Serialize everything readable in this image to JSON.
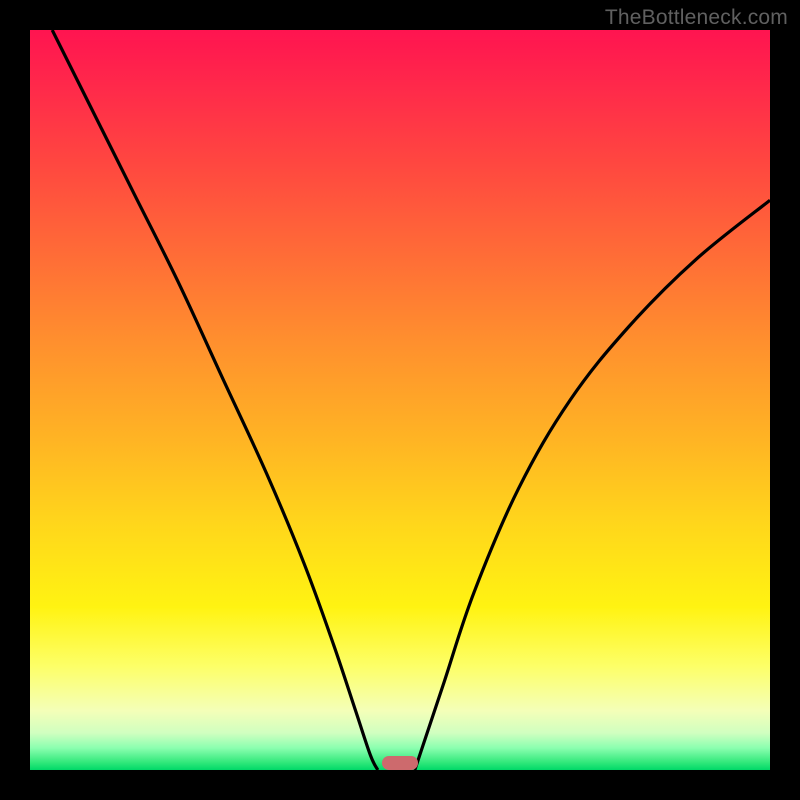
{
  "watermark": "TheBottleneck.com",
  "chart_data": {
    "type": "line",
    "title": "",
    "xlabel": "",
    "ylabel": "",
    "xlim": [
      0,
      100
    ],
    "ylim": [
      0,
      100
    ],
    "background_gradient": {
      "top": "#ff1450",
      "mid_upper": "#ff8f2e",
      "mid_lower": "#fff312",
      "bottom": "#00d868"
    },
    "series": [
      {
        "name": "left_curve",
        "points": [
          {
            "x": 3,
            "y": 100
          },
          {
            "x": 8,
            "y": 90
          },
          {
            "x": 14,
            "y": 78
          },
          {
            "x": 20,
            "y": 66
          },
          {
            "x": 26,
            "y": 53
          },
          {
            "x": 32,
            "y": 40
          },
          {
            "x": 37,
            "y": 28
          },
          {
            "x": 41,
            "y": 17
          },
          {
            "x": 44,
            "y": 8
          },
          {
            "x": 46,
            "y": 2
          },
          {
            "x": 47,
            "y": 0
          }
        ]
      },
      {
        "name": "right_curve",
        "points": [
          {
            "x": 52,
            "y": 0
          },
          {
            "x": 53,
            "y": 3
          },
          {
            "x": 56,
            "y": 12
          },
          {
            "x": 60,
            "y": 24
          },
          {
            "x": 66,
            "y": 38
          },
          {
            "x": 73,
            "y": 50
          },
          {
            "x": 81,
            "y": 60
          },
          {
            "x": 90,
            "y": 69
          },
          {
            "x": 100,
            "y": 77
          }
        ]
      }
    ],
    "marker": {
      "x_center": 50,
      "y": 0,
      "color": "#cd6a6d",
      "shape": "rounded-bar"
    }
  }
}
